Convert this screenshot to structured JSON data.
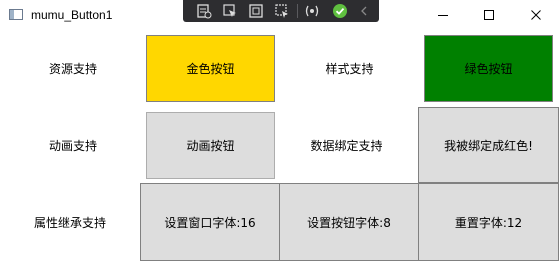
{
  "window": {
    "title": "mumu_Button1",
    "icon": "app-window-icon",
    "controls": [
      "minimize-icon",
      "maximize-icon",
      "close-icon"
    ]
  },
  "devtools": {
    "icons": [
      "live-visual-tree-icon",
      "select-element-icon",
      "display-layout-adorners-icon",
      "track-focus-icon",
      "binding-failures-icon",
      "hot-reload-ok-icon",
      "collapse-icon"
    ]
  },
  "colors": {
    "gold": "#FFD700",
    "green": "#008000",
    "button_gray": "#DDDDDD",
    "border_gray": "#ADADAD"
  },
  "rows": [
    {
      "left_label": "资源支持",
      "button1": "金色按钮",
      "mid_label": "样式支持",
      "button2": "绿色按钮"
    },
    {
      "left_label": "动画支持",
      "button1": "动画按钮",
      "mid_label": "数据绑定支持",
      "button2": "我被绑定成红色!"
    },
    {
      "left_label": "属性继承支持",
      "button1": "设置窗口字体:16",
      "button2": "设置按钮字体:8",
      "button3": "重置字体:12"
    }
  ]
}
